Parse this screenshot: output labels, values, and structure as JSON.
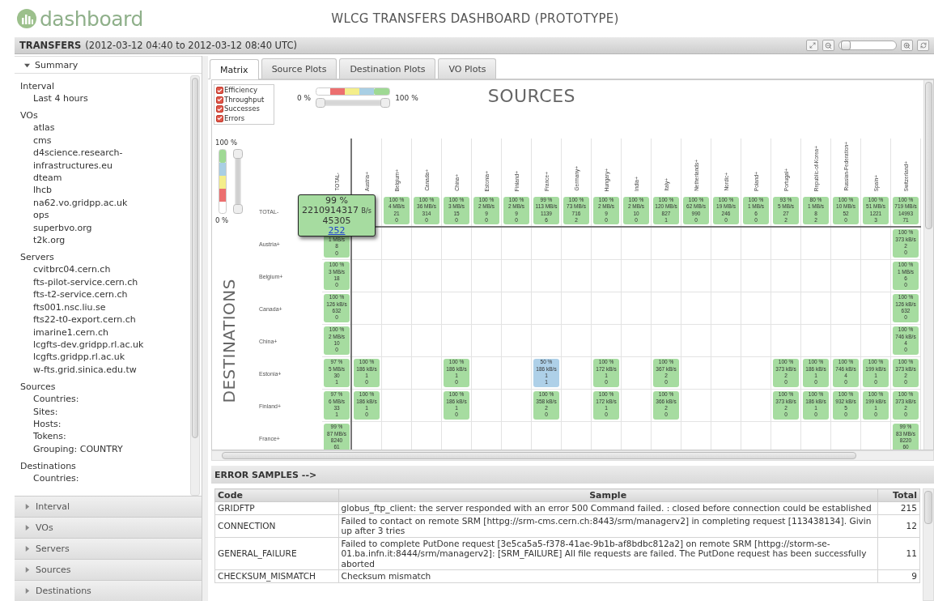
{
  "header": {
    "logo": "dashboard",
    "title": "WLCG TRANSFERS DASHBOARD (PROTOTYPE)"
  },
  "transfers_bar": {
    "title": "TRANSFERS",
    "range": "(2012-03-12 04:40 to 2012-03-12 08:40 UTC)",
    "zoom_slider": {
      "level": 0.12
    }
  },
  "sidebar": {
    "summary": {
      "label": "Summary",
      "expanded": true
    },
    "sections": [
      {
        "title": "Interval",
        "items": [
          "Last 4 hours"
        ]
      },
      {
        "title": "VOs",
        "items": [
          "atlas",
          "cms",
          "d4science.research-infrastructures.eu",
          "dteam",
          "lhcb",
          "na62.vo.gridpp.ac.uk",
          "ops",
          "superbvo.org",
          "t2k.org"
        ]
      },
      {
        "title": "Servers",
        "items": [
          "cvitbrc04.cern.ch",
          "fts-pilot-service.cern.ch",
          "fts-t2-service.cern.ch",
          "fts001.nsc.liu.se",
          "fts22-t0-export.cern.ch",
          "imarine1.cern.ch",
          "lcgfts-dev.gridpp.rl.ac.uk",
          "lcgfts.gridpp.rl.ac.uk",
          "w-fts.grid.sinica.edu.tw"
        ]
      },
      {
        "title": "Sources",
        "items": [
          "Countries:",
          "Sites:",
          "Hosts:",
          "Tokens:",
          "Grouping: COUNTRY"
        ]
      },
      {
        "title": "Destinations",
        "items": [
          "Countries:"
        ]
      }
    ],
    "panels": [
      {
        "label": "Interval",
        "expanded": false
      },
      {
        "label": "VOs",
        "expanded": false
      },
      {
        "label": "Servers",
        "expanded": false
      },
      {
        "label": "Sources",
        "expanded": false
      },
      {
        "label": "Destinations",
        "expanded": false
      }
    ]
  },
  "tabs": [
    {
      "label": "Matrix",
      "selected": true
    },
    {
      "label": "Source Plots",
      "selected": false
    },
    {
      "label": "Destination Plots",
      "selected": false
    },
    {
      "label": "VO Plots",
      "selected": false
    }
  ],
  "matrix": {
    "legend": [
      {
        "label": "Efficiency",
        "checked": true
      },
      {
        "label": "Throughput",
        "checked": true
      },
      {
        "label": "Successes",
        "checked": true
      },
      {
        "label": "Errors",
        "checked": true
      }
    ],
    "range_min": "0 %",
    "range_max": "100 %",
    "efficiency_range": {
      "level": 1
    },
    "scale_range": {
      "level": 1
    },
    "sources_title": "SOURCES",
    "scale_max": "100 %",
    "scale_min": "0 %",
    "destinations_title": "DESTINATIONS",
    "total_tooltip": {
      "efficiency": "99 %",
      "rate_value": "2210914317",
      "rate_unit": "B/s",
      "files": "45305",
      "errors": "252"
    },
    "columns": [
      "TOTAL-",
      "Austria+",
      "Belgium+",
      "Canada+",
      "China+",
      "Estonia+",
      "Finland+",
      "France+",
      "Germany+",
      "Hungary+",
      "India+",
      "Italy+",
      "Netherlands+",
      "Nordic+",
      "Poland+",
      "Portugal+",
      "Republic-of-Korea+",
      "Russian-Federation+",
      "Spain+",
      "Switzerland+"
    ],
    "rows": [
      {
        "label": "TOTAL-",
        "cells": [
          null,
          null,
          {
            "lines": [
              "100 %",
              "4 MB/s",
              "21",
              "0"
            ],
            "color": "#a6dca0"
          },
          {
            "lines": [
              "100 %",
              "36 MB/s",
              "314",
              "0"
            ],
            "color": "#a6dca0"
          },
          {
            "lines": [
              "100 %",
              "3 MB/s",
              "15",
              "0"
            ],
            "color": "#a6dca0"
          },
          {
            "lines": [
              "100 %",
              "2 MB/s",
              "9",
              "0"
            ],
            "color": "#a6dca0"
          },
          {
            "lines": [
              "100 %",
              "2 MB/s",
              "9",
              "0"
            ],
            "color": "#a6dca0"
          },
          {
            "lines": [
              "99 %",
              "113 MB/s",
              "1139",
              "6"
            ],
            "color": "#a6dca0"
          },
          {
            "lines": [
              "100 %",
              "73 MB/s",
              "716",
              "2"
            ],
            "color": "#a6dca0"
          },
          {
            "lines": [
              "100 %",
              "2 MB/s",
              "9",
              "0"
            ],
            "color": "#a6dca0"
          },
          {
            "lines": [
              "100 %",
              "2 MB/s",
              "10",
              "0"
            ],
            "color": "#a6dca0"
          },
          {
            "lines": [
              "100 %",
              "120 MB/s",
              "827",
              "1"
            ],
            "color": "#a6dca0"
          },
          {
            "lines": [
              "100 %",
              "62 MB/s",
              "990",
              "0"
            ],
            "color": "#a6dca0"
          },
          {
            "lines": [
              "100 %",
              "19 MB/s",
              "246",
              "0"
            ],
            "color": "#a6dca0"
          },
          {
            "lines": [
              "100 %",
              "1 MB/s",
              "6",
              "0"
            ],
            "color": "#a6dca0"
          },
          {
            "lines": [
              "93 %",
              "5 MB/s",
              "27",
              "2"
            ],
            "color": "#a6dca0"
          },
          {
            "lines": [
              "80 %",
              "1 MB/s",
              "8",
              "2"
            ],
            "color": "#a6dca0"
          },
          {
            "lines": [
              "100 %",
              "10 MB/s",
              "52",
              "0"
            ],
            "color": "#a6dca0"
          },
          {
            "lines": [
              "100 %",
              "51 MB/s",
              "1221",
              "3"
            ],
            "color": "#a6dca0"
          },
          {
            "lines": [
              "100 %",
              "719 MB/s",
              "14993",
              "71"
            ],
            "color": "#a6dca0"
          }
        ]
      },
      {
        "label": "Austria+",
        "cells": [
          {
            "lines": [
              "1 MB/s",
              "8",
              "0"
            ],
            "color": "#a6dca0"
          },
          null,
          null,
          null,
          null,
          null,
          null,
          null,
          null,
          null,
          null,
          null,
          null,
          null,
          null,
          null,
          null,
          null,
          null,
          {
            "lines": [
              "100 %",
              "373 kB/s",
              "2",
              "0"
            ],
            "color": "#a6dca0"
          }
        ]
      },
      {
        "label": "Belgium+",
        "cells": [
          {
            "lines": [
              "100 %",
              "3 MB/s",
              "18",
              "0"
            ],
            "color": "#a6dca0"
          },
          null,
          null,
          null,
          null,
          null,
          null,
          null,
          null,
          null,
          null,
          null,
          null,
          null,
          null,
          null,
          null,
          null,
          null,
          {
            "lines": [
              "100 %",
              "1 MB/s",
              "6",
              "0"
            ],
            "color": "#a6dca0"
          }
        ]
      },
      {
        "label": "Canada+",
        "cells": [
          {
            "lines": [
              "100 %",
              "126 kB/s",
              "632",
              "0"
            ],
            "color": "#a6dca0"
          },
          null,
          null,
          null,
          null,
          null,
          null,
          null,
          null,
          null,
          null,
          null,
          null,
          null,
          null,
          null,
          null,
          null,
          null,
          {
            "lines": [
              "100 %",
              "126 kB/s",
              "632",
              "0"
            ],
            "color": "#a6dca0"
          }
        ]
      },
      {
        "label": "China+",
        "cells": [
          {
            "lines": [
              "100 %",
              "2 MB/s",
              "10",
              "0"
            ],
            "color": "#a6dca0"
          },
          null,
          null,
          null,
          null,
          null,
          null,
          null,
          null,
          null,
          null,
          null,
          null,
          null,
          null,
          null,
          null,
          null,
          null,
          {
            "lines": [
              "100 %",
              "746 kB/s",
              "4",
              "0"
            ],
            "color": "#a6dca0"
          }
        ]
      },
      {
        "label": "Estonia+",
        "cells": [
          {
            "lines": [
              "97 %",
              "5 MB/s",
              "30",
              "1"
            ],
            "color": "#a6dca0"
          },
          {
            "lines": [
              "100 %",
              "186 kB/s",
              "1",
              "0"
            ],
            "color": "#a6dca0"
          },
          null,
          null,
          {
            "lines": [
              "100 %",
              "186 kB/s",
              "1",
              "0"
            ],
            "color": "#a6dca0"
          },
          null,
          null,
          {
            "lines": [
              "50 %",
              "186 kB/s",
              "1",
              "1"
            ],
            "color": "#aed0e8"
          },
          null,
          {
            "lines": [
              "100 %",
              "172 kB/s",
              "1",
              "0"
            ],
            "color": "#a6dca0"
          },
          null,
          {
            "lines": [
              "100 %",
              "367 kB/s",
              "2",
              "0"
            ],
            "color": "#a6dca0"
          },
          null,
          null,
          null,
          {
            "lines": [
              "100 %",
              "373 kB/s",
              "2",
              "0"
            ],
            "color": "#a6dca0"
          },
          {
            "lines": [
              "100 %",
              "186 kB/s",
              "1",
              "0"
            ],
            "color": "#a6dca0"
          },
          {
            "lines": [
              "100 %",
              "746 kB/s",
              "4",
              "0"
            ],
            "color": "#a6dca0"
          },
          {
            "lines": [
              "100 %",
              "199 kB/s",
              "1",
              "0"
            ],
            "color": "#a6dca0"
          },
          {
            "lines": [
              "100 %",
              "373 kB/s",
              "2",
              "0"
            ],
            "color": "#a6dca0"
          }
        ]
      },
      {
        "label": "Finland+",
        "cells": [
          {
            "lines": [
              "97 %",
              "6 MB/s",
              "33",
              "1"
            ],
            "color": "#a6dca0"
          },
          {
            "lines": [
              "100 %",
              "186 kB/s",
              "1",
              "0"
            ],
            "color": "#a6dca0"
          },
          null,
          null,
          {
            "lines": [
              "100 %",
              "186 kB/s",
              "1",
              "0"
            ],
            "color": "#a6dca0"
          },
          null,
          null,
          {
            "lines": [
              "100 %",
              "358 kB/s",
              "2",
              "0"
            ],
            "color": "#a6dca0"
          },
          null,
          {
            "lines": [
              "100 %",
              "172 kB/s",
              "1",
              "0"
            ],
            "color": "#a6dca0"
          },
          null,
          {
            "lines": [
              "100 %",
              "366 kB/s",
              "2",
              "0"
            ],
            "color": "#a6dca0"
          },
          null,
          null,
          null,
          {
            "lines": [
              "100 %",
              "373 kB/s",
              "2",
              "0"
            ],
            "color": "#a6dca0"
          },
          {
            "lines": [
              "100 %",
              "186 kB/s",
              "1",
              "0"
            ],
            "color": "#a6dca0"
          },
          {
            "lines": [
              "100 %",
              "932 kB/s",
              "5",
              "0"
            ],
            "color": "#a6dca0"
          },
          {
            "lines": [
              "100 %",
              "199 kB/s",
              "1",
              "0"
            ],
            "color": "#a6dca0"
          },
          {
            "lines": [
              "100 %",
              "373 kB/s",
              "2",
              "0"
            ],
            "color": "#a6dca0"
          }
        ]
      },
      {
        "label": "France+",
        "cells": [
          {
            "lines": [
              "99 %",
              "87 MB/s",
              "8240",
              "61"
            ],
            "color": "#a6dca0"
          },
          null,
          null,
          null,
          null,
          null,
          null,
          null,
          null,
          null,
          null,
          null,
          null,
          null,
          null,
          null,
          null,
          null,
          null,
          {
            "lines": [
              "99 %",
              "83 MB/s",
              "8220",
              "60"
            ],
            "color": "#a6dca0"
          }
        ]
      }
    ]
  },
  "error_samples": {
    "title": "ERROR SAMPLES -->",
    "columns": [
      "Code",
      "Sample",
      "Total"
    ],
    "rows": [
      {
        "code": "GRIDFTP",
        "sample": "globus_ftp_client: the server responded with an error 500 Command failed. : closed before connection could be established",
        "total": "215"
      },
      {
        "code": "CONNECTION",
        "sample": "Failed to contact on remote SRM [httpg://srm-cms.cern.ch:8443/srm/managerv2] in completing request [113438134]. Givin up after 3 tries",
        "total": "12"
      },
      {
        "code": "GENERAL_FAILURE",
        "sample": "Failed to complete PutDone request [3e5ca5a5-f378-41ae-9b1b-af8bdbc812a2] on remote SRM [httpg://storm-se-01.ba.infn.it:8444/srm/managerv2]: [SRM_FAILURE] All file requests are failed. The PutDone request has been successfully aborted",
        "total": "11"
      },
      {
        "code": "CHECKSUM_MISMATCH",
        "sample": "Checksum mismatch",
        "total": "9"
      }
    ]
  }
}
